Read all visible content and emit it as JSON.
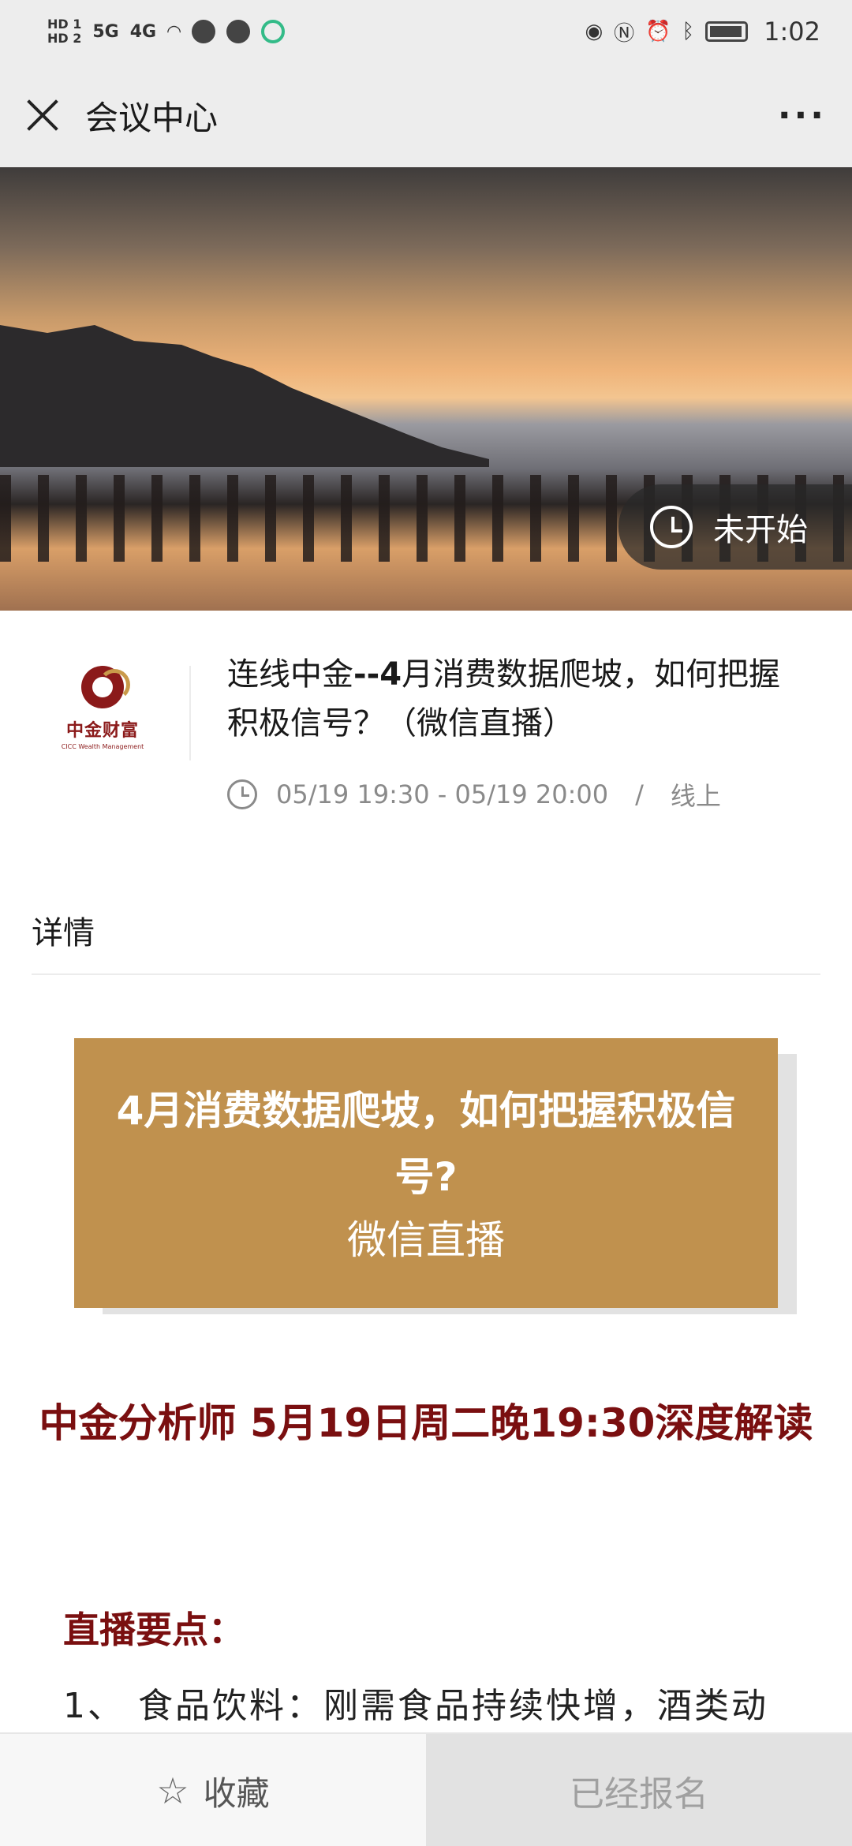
{
  "status_bar": {
    "hd1": "HD 1",
    "hd2": "HD 2",
    "net1": "5G",
    "net2": "4G",
    "time": "1:02"
  },
  "nav": {
    "title": "会议中心",
    "more": "···"
  },
  "banner": {
    "status": "未开始"
  },
  "event": {
    "logo_cn": "中金财富",
    "logo_en": "CICC Wealth Management",
    "title_prefix": "连线中金",
    "title_bold": "--4",
    "title_rest": "月消费数据爬坡，如何把握积极信号？（微信直播）",
    "time": "05/19 19:30 - 05/19 20:00",
    "separator": "/",
    "location": "线上"
  },
  "details": {
    "heading": "详情",
    "card_title": "4月消费数据爬坡，如何把握积极信号?",
    "card_subtitle": "微信直播",
    "analyst_line": "中金分析师 5月19日周二晚19:30深度解读",
    "points_heading": "直播要点：",
    "point_1": "1、 食品饮料：刚需食品持续快增，酒类动"
  },
  "bottom": {
    "favorite": "收藏",
    "registered": "已经报名"
  }
}
